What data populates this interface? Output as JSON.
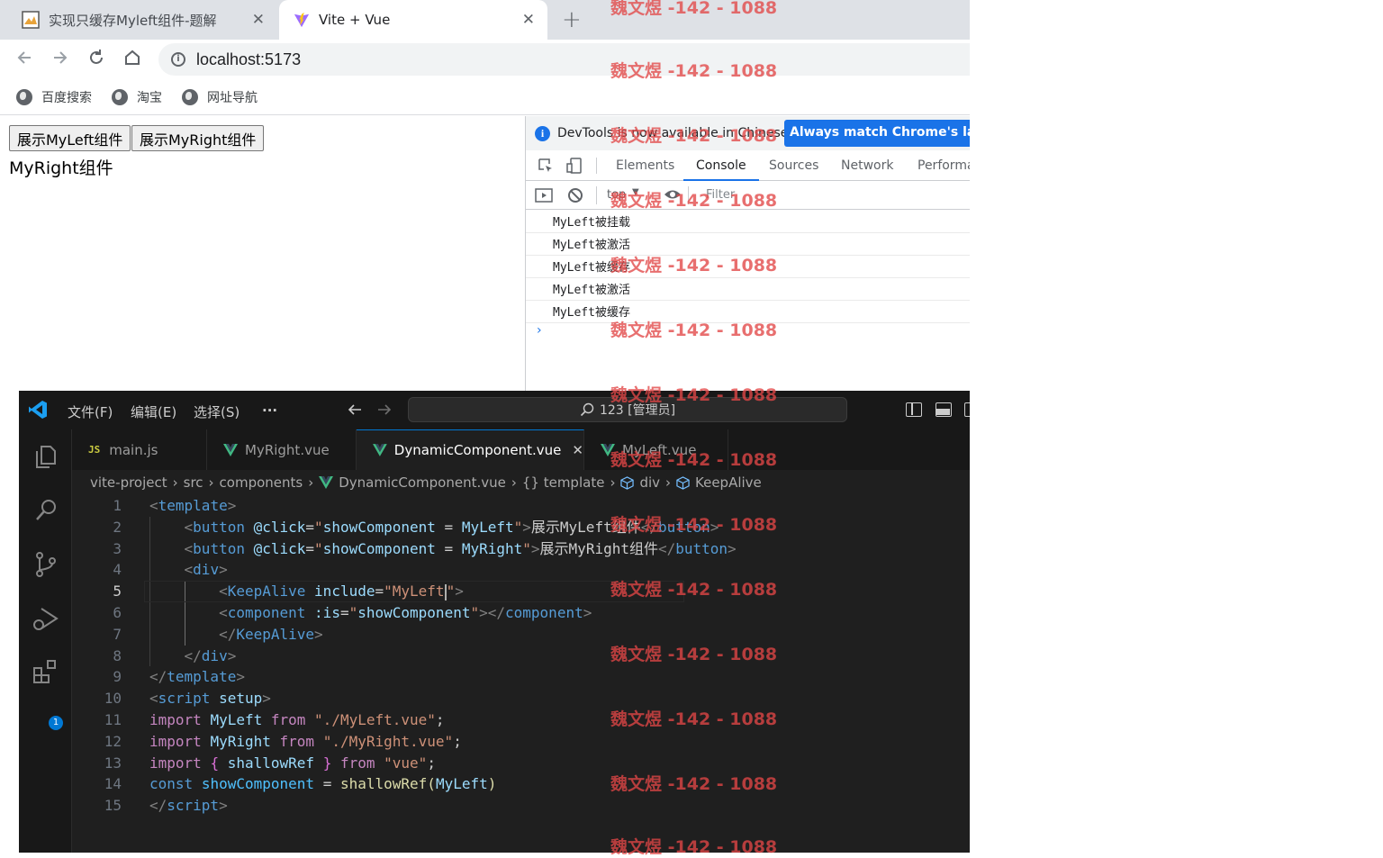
{
  "browser": {
    "tabs": [
      {
        "title": "实现只缓存Myleft组件-题解",
        "close": "✕"
      },
      {
        "title": "Vite + Vue",
        "close": "✕"
      }
    ],
    "new_tab": "+",
    "address": "localhost:5173",
    "bookmarks": [
      "百度搜索",
      "淘宝",
      "网址导航"
    ]
  },
  "page": {
    "buttons": [
      "展示MyLeft组件",
      "展示MyRight组件"
    ],
    "component_text": "MyRight组件"
  },
  "devtools": {
    "banner_text": "DevTools is now available in Chinese!",
    "banner_button": "Always match Chrome's language",
    "tabs": [
      "Elements",
      "Console",
      "Sources",
      "Network",
      "Performance"
    ],
    "active_tab": "Console",
    "context": "top",
    "filter_placeholder": "Filter",
    "logs": [
      "MyLeft被挂载",
      "MyLeft被激活",
      "MyLeft被缓存",
      "MyLeft被激活",
      "MyLeft被缓存"
    ],
    "prompt": "›"
  },
  "vscode": {
    "menu": [
      "文件(F)",
      "编辑(E)",
      "选择(S)",
      "···"
    ],
    "search": "123 [管理员]",
    "extensions_badge": "1",
    "tabs": [
      {
        "label": "main.js",
        "type": "JS"
      },
      {
        "label": "MyRight.vue",
        "type": "vue"
      },
      {
        "label": "DynamicComponent.vue",
        "type": "vue",
        "active": true
      },
      {
        "label": "MyLeft.vue",
        "type": "vue"
      }
    ],
    "breadcrumb": [
      "vite-project",
      "src",
      "components",
      "DynamicComponent.vue",
      "{} template",
      "div",
      "KeepAlive"
    ],
    "line_numbers": [
      "1",
      "2",
      "3",
      "4",
      "5",
      "6",
      "7",
      "8",
      "9",
      "10",
      "11",
      "12",
      "13",
      "14",
      "15"
    ],
    "current_line": "5",
    "code": {
      "l1": {
        "open": "<",
        "tag": "template",
        "close": ">"
      },
      "l2": {
        "open": "<",
        "tag": "button",
        "attr": "@click",
        "eq": "=",
        "q1": "\"",
        "v1": "showComponent",
        "op": " = ",
        "v2": "MyLeft",
        "q2": "\"",
        "gt": ">",
        "text": "展示MyLeft组件",
        "endopen": "</",
        "endtag": "button",
        "endclose": ">"
      },
      "l3": {
        "open": "<",
        "tag": "button",
        "attr": "@click",
        "eq": "=",
        "q1": "\"",
        "v1": "showComponent",
        "op": " = ",
        "v2": "MyRight",
        "q2": "\"",
        "gt": ">",
        "text": "展示MyRight组件",
        "endopen": "</",
        "endtag": "button",
        "endclose": ">"
      },
      "l4": {
        "open": "<",
        "tag": "div",
        "close": ">"
      },
      "l5": {
        "open": "<",
        "tag": "KeepAlive",
        "attr": "include",
        "eq": "=",
        "val": "\"MyLeft",
        "q": "\"",
        "close": ">"
      },
      "l6": {
        "open": "<",
        "tag": "component",
        "attr": ":is",
        "eq": "=",
        "q1": "\"",
        "val": "showComponent",
        "q2": "\"",
        "gt": "></",
        "endtag": "component",
        "close": ">"
      },
      "l7": {
        "open": "</",
        "tag": "KeepAlive",
        "close": ">"
      },
      "l8": {
        "open": "</",
        "tag": "div",
        "close": ">"
      },
      "l9": {
        "open": "</",
        "tag": "template",
        "close": ">"
      },
      "l10": {
        "open": "<",
        "tag": "script",
        "attr": "setup",
        "close": ">"
      },
      "l11": {
        "kw": "import",
        "name": "MyLeft",
        "from": "from",
        "path": "\"./MyLeft.vue\"",
        "semi": ";"
      },
      "l12": {
        "kw": "import",
        "name": "MyRight",
        "from": "from",
        "path": "\"./MyRight.vue\"",
        "semi": ";"
      },
      "l13": {
        "kw": "import",
        "b1": "{",
        "name": "shallowRef",
        "b2": "}",
        "from": "from",
        "path": "\"vue\"",
        "semi": ";"
      },
      "l14": {
        "kw": "const",
        "name": "showComponent",
        "eq": "=",
        "fn": "shallowRef",
        "p1": "(",
        "arg": "MyLeft",
        "p2": ")"
      },
      "l15": {
        "open": "</",
        "tag": "script",
        "close": ">"
      }
    }
  },
  "watermark": "魏文煜 -142 - 1088",
  "colors": {
    "accent": "#1a73e8",
    "vscode_bg": "#1f1f1f",
    "watermark": "#e24646"
  }
}
